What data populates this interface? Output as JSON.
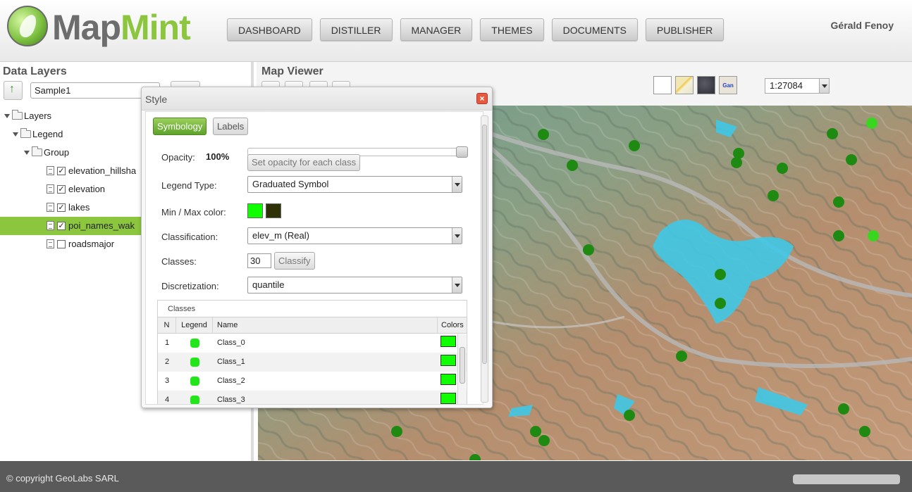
{
  "header": {
    "logo_map": "Map",
    "logo_mint": "Mint",
    "nav": [
      "DASHBOARD",
      "DISTILLER",
      "MANAGER",
      "THEMES",
      "DOCUMENTS",
      "PUBLISHER"
    ],
    "user": "Gérald Fenoy"
  },
  "data_layers": {
    "title": "Data Layers",
    "project": "Sample1",
    "tree": [
      {
        "label": "Layers",
        "type": "folder",
        "level": 0
      },
      {
        "label": "Legend",
        "type": "folder",
        "level": 1
      },
      {
        "label": "Group",
        "type": "folder",
        "level": 2
      },
      {
        "label": "elevation_hillsha",
        "type": "layer",
        "checked": true
      },
      {
        "label": "elevation",
        "type": "layer",
        "checked": true
      },
      {
        "label": "lakes",
        "type": "layer",
        "checked": true
      },
      {
        "label": "poi_names_wak",
        "type": "layer",
        "checked": true,
        "selected": true
      },
      {
        "label": "roadsmajor",
        "type": "layer",
        "checked": false
      }
    ]
  },
  "map_viewer": {
    "title": "Map Viewer",
    "scale": "1:27084",
    "base_layers": [
      "blank-icon",
      "roads-icon",
      "satellite-icon",
      "google-icon"
    ],
    "google_label": "Gan"
  },
  "style_dialog": {
    "title": "Style",
    "tabs": [
      "Symbology",
      "Labels"
    ],
    "opacity_label": "Opacity:",
    "opacity_value": "100%",
    "opacity_fraction": 1.0,
    "opacity_button": "Set opacity for each class",
    "legend_type_label": "Legend Type:",
    "legend_type": "Graduated Symbol",
    "minmax_label": "Min / Max color:",
    "min_color": "#10ff00",
    "max_color": "#2f3206",
    "classification_label": "Classification:",
    "classification": "elev_m (Real)",
    "classes_label": "Classes:",
    "classes_value": "30",
    "classify_button": "Classify",
    "discretization_label": "Discretization:",
    "discretization": "quantile",
    "classes_caption": "Classes",
    "grid_headers": [
      "N",
      "Legend",
      "Name",
      "Colors"
    ],
    "rows": [
      {
        "n": "1",
        "name": "Class_0"
      },
      {
        "n": "2",
        "name": "Class_1"
      },
      {
        "n": "3",
        "name": "Class_2"
      },
      {
        "n": "4",
        "name": "Class_3"
      }
    ]
  },
  "footer": {
    "copyright": "© copyright GeoLabs SARL"
  },
  "colors": {
    "accent_green": "#8cc63f",
    "lake_blue": "#3fc8e6",
    "poi_green": "#1f8a12"
  }
}
